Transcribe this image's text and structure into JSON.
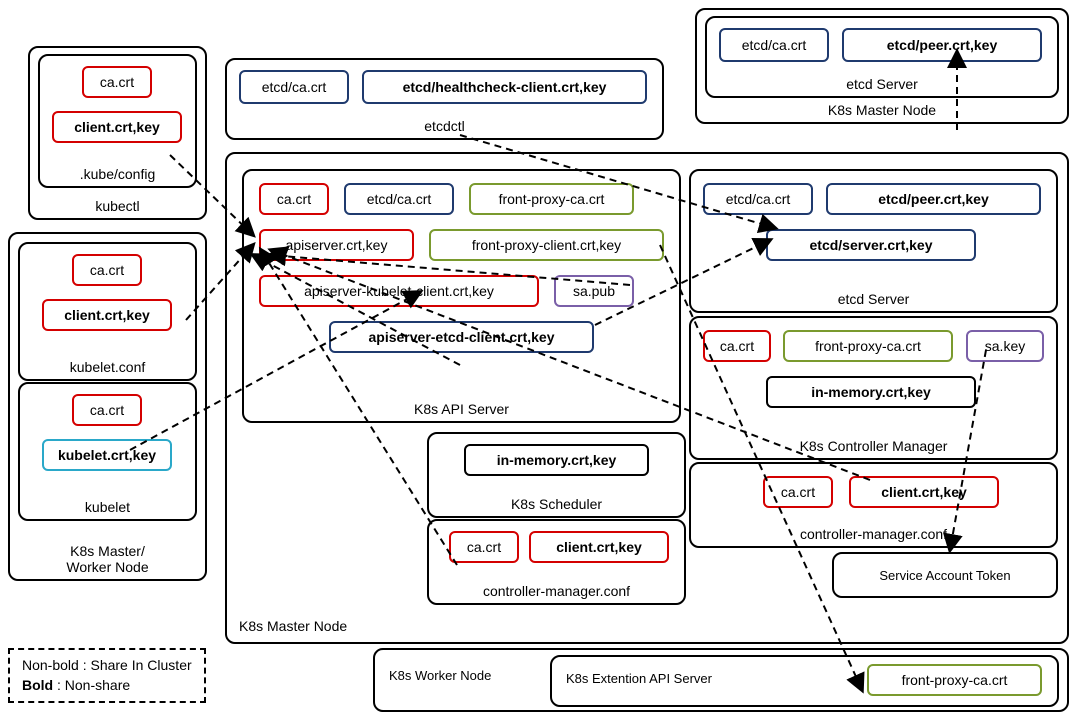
{
  "legend": {
    "line1": "Non-bold : Share In Cluster",
    "line2_bold": "Bold",
    "line2_rest": " : Non-share"
  },
  "top_master": {
    "label": "K8s Master Node",
    "etcd_server_label": "etcd Server",
    "etcd_ca": "etcd/ca.crt",
    "etcd_peer": "etcd/peer.crt,key"
  },
  "etcdctl": {
    "label": "etcdctl",
    "etcd_ca": "etcd/ca.crt",
    "hc_client": "etcd/healthcheck-client.crt,key"
  },
  "kubectl_block": {
    "label": "kubectl",
    "kubeconfig_label": ".kube/config",
    "ca": "ca.crt",
    "client": "client.crt,key"
  },
  "mw_node": {
    "label": "K8s Master/\nWorker Node",
    "kubelet_conf_label": "kubelet.conf",
    "ca1": "ca.crt",
    "client": "client.crt,key",
    "kubelet_label": "kubelet",
    "ca2": "ca.crt",
    "kubelet_cert": "kubelet.crt,key"
  },
  "master": {
    "label": "K8s Master Node",
    "api": {
      "label": "K8s API Server",
      "ca": "ca.crt",
      "etcd_ca": "etcd/ca.crt",
      "fp_ca": "front-proxy-ca.crt",
      "apiserver": "apiserver.crt,key",
      "fp_client": "front-proxy-client.crt,key",
      "kubelet_client": "apiserver-kubelet-client.crt,key",
      "sa_pub": "sa.pub",
      "etcd_client": "apiserver-etcd-client.crt,key"
    },
    "etcd": {
      "label": "etcd Server",
      "etcd_ca": "etcd/ca.crt",
      "peer": "etcd/peer.crt,key",
      "server": "etcd/server.crt,key"
    },
    "cm": {
      "label": "K8s Controller Manager",
      "ca": "ca.crt",
      "fp_ca": "front-proxy-ca.crt",
      "sa_key": "sa.key",
      "inmem": "in-memory.crt,key",
      "conf_label": "controller-manager.conf",
      "conf_ca": "ca.crt",
      "conf_client": "client.crt,key",
      "sat": "Service Account Token"
    },
    "sched": {
      "label": "K8s Scheduler",
      "inmem": "in-memory.crt,key",
      "conf_label": "controller-manager.conf",
      "conf_ca": "ca.crt",
      "conf_client": "client.crt,key"
    }
  },
  "worker": {
    "label": "K8s Worker Node",
    "ext_label": "K8s Extention API Server",
    "fp_ca": "front-proxy-ca.crt"
  }
}
